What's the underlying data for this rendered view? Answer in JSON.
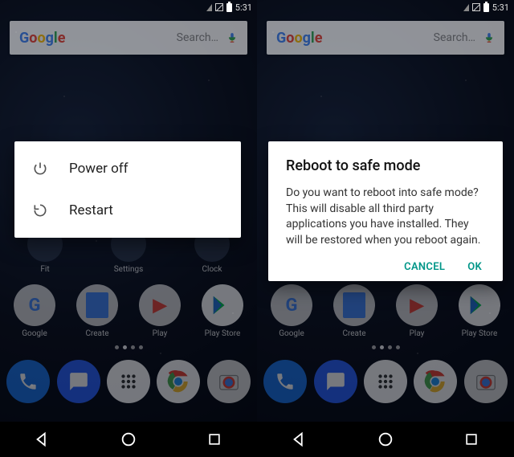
{
  "status": {
    "time": "5:31"
  },
  "search": {
    "placeholder": "Search…"
  },
  "quick_apps": [
    {
      "label": "Fit"
    },
    {
      "label": "Settings"
    },
    {
      "label": "Clock"
    }
  ],
  "app_folders": [
    {
      "label": "Google"
    },
    {
      "label": "Create"
    },
    {
      "label": "Play"
    },
    {
      "label": "Play Store"
    }
  ],
  "power_menu": {
    "items": [
      {
        "label": "Power off"
      },
      {
        "label": "Restart"
      }
    ]
  },
  "safe_mode_dialog": {
    "title": "Reboot to safe mode",
    "body": "Do you want to reboot into safe mode? This will disable all third party applications you have installed. They will be restored when you reboot again.",
    "cancel": "CANCEL",
    "ok": "OK"
  }
}
